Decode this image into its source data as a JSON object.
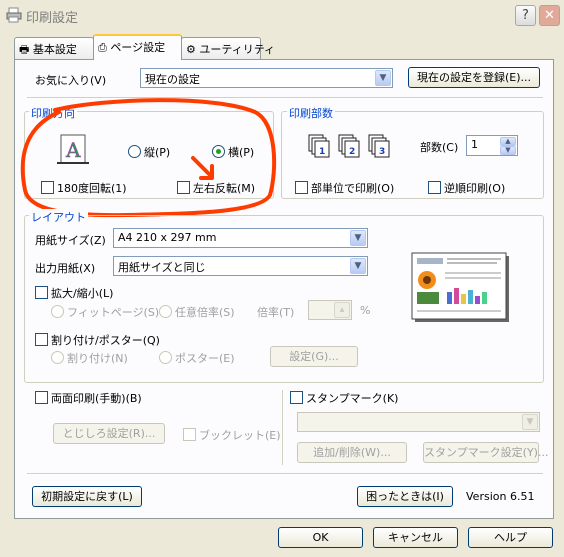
{
  "window": {
    "title": "印刷設定",
    "help_btn": "?",
    "close_btn": "✕"
  },
  "tabs": [
    {
      "label": "基本設定"
    },
    {
      "label": "ページ設定"
    },
    {
      "label": "ユーティリティ"
    }
  ],
  "favorites": {
    "label": "お気に入り(V)",
    "value": "現在の設定",
    "register_btn": "現在の設定を登録(E)..."
  },
  "orientation": {
    "group_label": "印刷方向",
    "portrait": "縦(P)",
    "landscape": "横(P)",
    "rotate180": "180度回転(1)",
    "mirror": "左右反転(M)"
  },
  "copies": {
    "group_label": "印刷部数",
    "count_label": "部数(C)",
    "count_value": "1",
    "collate": "部単位で印刷(O)",
    "reverse": "逆順印刷(O)"
  },
  "layout": {
    "group_label": "レイアウト",
    "paper_size_label": "用紙サイズ(Z)",
    "paper_size_value": "A4 210 x 297 mm",
    "output_paper_label": "出力用紙(X)",
    "output_paper_value": "用紙サイズと同じ",
    "zoom_label": "拡大/縮小(L)",
    "fit_page": "フィットページ(S)",
    "custom_ratio": "任意倍率(S)",
    "ratio_label": "倍率(T)",
    "ratio_unit": "%",
    "nup_label": "割り付け/ポスター(Q)",
    "nup": "割り付け(N)",
    "poster": "ポスター(E)",
    "settings_btn": "設定(G)..."
  },
  "duplex": {
    "label": "両面印刷(手動)(B)",
    "binding_btn": "とじしろ設定(R)...",
    "booklet": "ブックレット(E)"
  },
  "stamp": {
    "label": "スタンプマーク(K)",
    "add_delete_btn": "追加/削除(W)...",
    "stamp_settings_btn": "スタンプマーク設定(Y)..."
  },
  "footer": {
    "reset_btn": "初期設定に戻す(L)",
    "trouble_btn": "困ったときは(I)",
    "version": "Version 6.51"
  },
  "dialog": {
    "ok": "OK",
    "cancel": "キャンセル",
    "help": "ヘルプ"
  },
  "colors": {
    "annotation": "#ff3c00",
    "group_label": "#0046d5"
  }
}
